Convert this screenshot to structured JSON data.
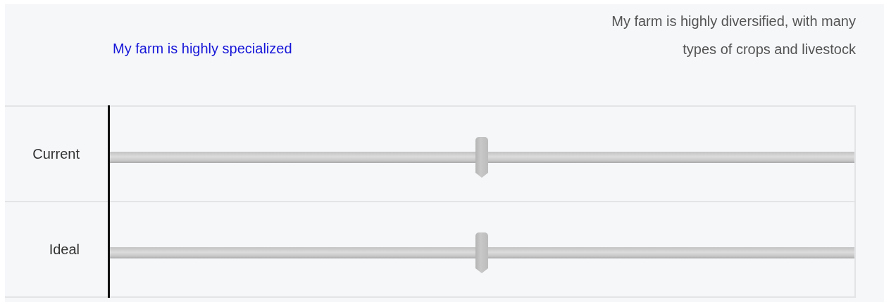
{
  "scale": {
    "left_label": "My farm is highly specialized",
    "right_label": "My farm is highly diversified, with many types of crops and livestock"
  },
  "rows": [
    {
      "label": "Current",
      "level": 0.5
    },
    {
      "label": "Ideal",
      "level": 0.5
    }
  ]
}
